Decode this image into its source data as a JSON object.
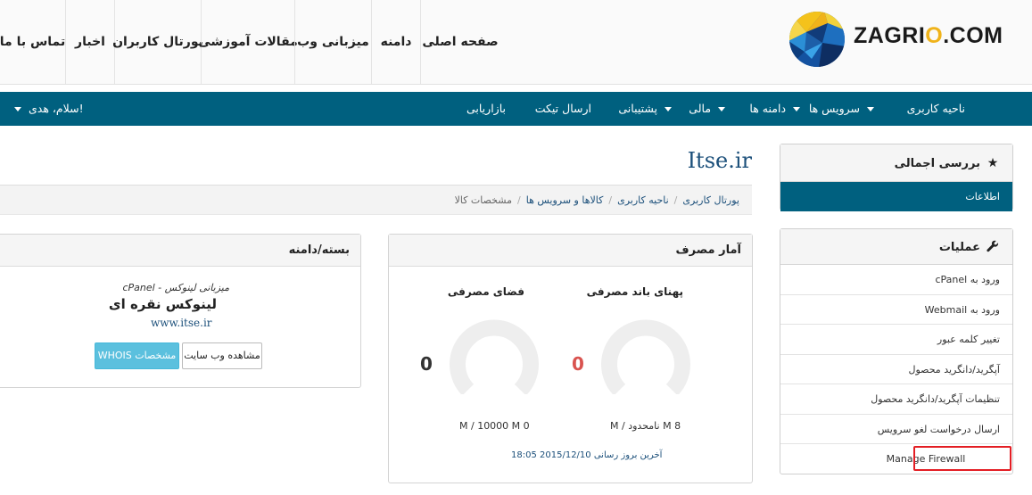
{
  "logo": {
    "text_main": "ZAGRI",
    "text_o": "O",
    "text_tail": ".COM"
  },
  "top_nav": [
    "تماس با ما",
    "اخبار",
    "پورتال کاربران",
    "مقالات آموزشی",
    "میزبانی وب",
    "دامنه",
    "صفحه اصلی"
  ],
  "teal_nav": {
    "items": [
      {
        "label": "ناحیه کاربری",
        "dropdown": false
      },
      {
        "label": "سرویس ها",
        "dropdown": true
      },
      {
        "label": "دامنه ها",
        "dropdown": true
      },
      {
        "label": "مالی",
        "dropdown": true
      },
      {
        "label": "پشتیبانی",
        "dropdown": true
      },
      {
        "label": "ارسال تیکت",
        "dropdown": false
      },
      {
        "label": "بازاریابی",
        "dropdown": false
      }
    ],
    "greeting": "سلام، هدی!"
  },
  "page_title": "Itse.ir",
  "breadcrumb": [
    "پورتال کاربری",
    "ناحیه کاربری",
    "کالاها و سرویس ها",
    "مشخصات کالا"
  ],
  "sidebar_overview": {
    "title": "بررسی اجمالی",
    "active_item": "اطلاعات"
  },
  "sidebar_actions": {
    "title": "عملیات",
    "items": [
      "ورود به cPanel",
      "ورود به Webmail",
      "تغییر کلمه عبور",
      "آپگرید/دانگرید محصول",
      "تنظیمات آپگرید/دانگرید محصول",
      "ارسال درخواست لغو سرویس",
      "Manage Firewall"
    ]
  },
  "usage_panel": {
    "title": "آمار مصرف",
    "bandwidth": {
      "label": "پهنای باند مصرفی",
      "value": "0",
      "caption": "M / نامحدود M 8",
      "color": "#d9534f"
    },
    "disk": {
      "label": "فضای مصرفی",
      "value": "0",
      "caption": "M / 10000 M 0",
      "color": "#333333"
    },
    "last_update": "آخرین بروز رسانی 2015/12/10 18:05"
  },
  "package_panel": {
    "title": "بسته/دامنه",
    "subtitle": "میزبانی لینوکس - cPanel",
    "name": "لینوکس نقره ای",
    "domain": "www.itse.ir",
    "btn_view_site": "مشاهده وب سایت",
    "btn_whois": "مشخصات WHOIS"
  },
  "colors": {
    "teal": "#00607f",
    "link": "#1b4f7a",
    "highlight": "#e31e24",
    "gauge_track": "#eeeeee"
  }
}
